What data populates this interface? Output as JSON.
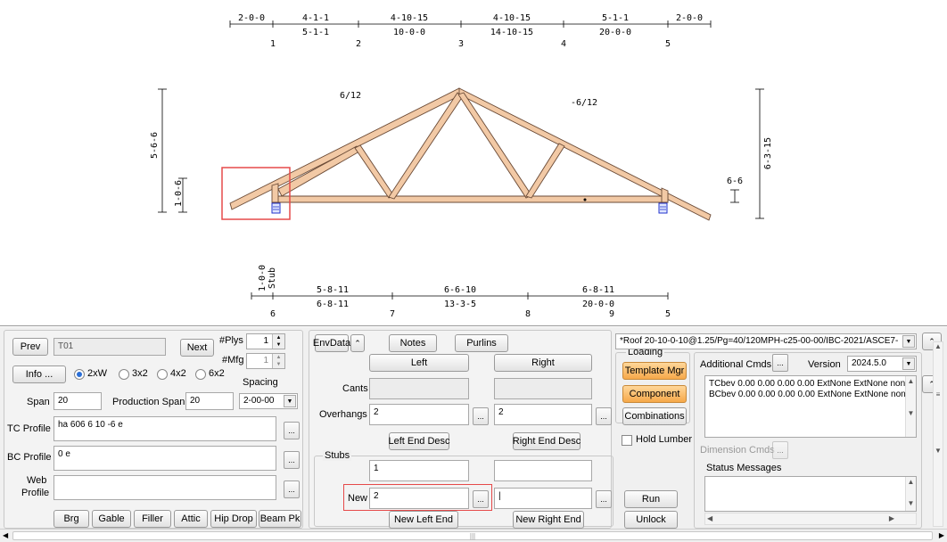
{
  "drawing": {
    "top_spans": [
      {
        "a": "2-0-0",
        "b": ""
      },
      {
        "a": "4-1-1",
        "b": "5-1-1"
      },
      {
        "a": "4-10-15",
        "b": "10-0-0"
      },
      {
        "a": "4-10-15",
        "b": "14-10-15"
      },
      {
        "a": "5-1-1",
        "b": "20-0-0"
      },
      {
        "a": "2-0-0",
        "b": ""
      }
    ],
    "top_joints": [
      "1",
      "2",
      "3",
      "4",
      "5"
    ],
    "pitch_left": "6/12",
    "pitch_right": "-6/12",
    "left_height": "5-6-6",
    "left_heel": "1-0-6",
    "right_height": "6-3-15",
    "right_heel": "6-6",
    "bottom_stub": "1-0-0",
    "bottom_stub_label": "Stub",
    "bottom_spans": [
      {
        "a": "5-8-11",
        "b": "6-8-11"
      },
      {
        "a": "6-6-10",
        "b": "13-3-5"
      },
      {
        "a": "6-8-11",
        "b": "20-0-0"
      }
    ],
    "bottom_joints": [
      "6",
      "7",
      "8",
      "9",
      "5"
    ]
  },
  "left": {
    "prev_label": "Prev",
    "truss_name": "T01",
    "next_label": "Next",
    "plys_label": "#Plys",
    "plys_value": "1",
    "mfg_label": "#Mfg",
    "mfg_value": "1",
    "info_label": "Info ...",
    "lumber_options": [
      "2xW",
      "3x2",
      "4x2",
      "6x2"
    ],
    "spacing_label": "Spacing",
    "span_label": "Span",
    "span_value": "20",
    "production_span_label": "Production Span",
    "production_span_value": "20",
    "spacing_value": "2-00-00",
    "tc_profile_label": "TC Profile",
    "tc_profile_value": "ha 606 6 10 -6 e",
    "bc_profile_label": "BC Profile",
    "bc_profile_value": "0 e",
    "web_profile_label1": "Web",
    "web_profile_label2": "Profile",
    "web_profile_value": "",
    "bottom_buttons": [
      "Brg",
      "Gable",
      "Filler",
      "Attic",
      "Hip Drop",
      "Beam Pk"
    ]
  },
  "middle": {
    "envdata_label": "EnvData",
    "notes_label": "Notes",
    "purlins_label": "Purlins",
    "left_tab": "Left",
    "right_tab": "Right",
    "cants_label": "Cants",
    "overhangs_label": "Overhangs",
    "overhang_left": "2",
    "overhang_right": "2",
    "left_end_desc": "Left End Desc",
    "right_end_desc": "Right End Desc",
    "stubs_label": "Stubs",
    "stub_left": "1",
    "stub_right": "",
    "new_label": "New",
    "new_left": "2",
    "new_right": "|",
    "new_left_end": "New Left End",
    "new_right_end": "New Right End"
  },
  "loading": {
    "label": "Loading",
    "template_mgr": "Template Mgr",
    "component": "Component",
    "combinations": "Combinations",
    "hold_lumber": "Hold Lumber",
    "run": "Run",
    "unlock": "Unlock"
  },
  "right": {
    "roof_combo": "*Roof 20-10-0-10@1.25/Pg=40/120MPH-c25-00-00/IBC-2021/ASCE7-",
    "additional_cmds_label": "Additional Cmds",
    "version_label": "Version",
    "version_value": "2024.5.0",
    "cmds_lines": [
      "TCbev 0.00 0.00 0.00 0.00 ExtNone ExtNone non",
      "BCbev 0.00 0.00 0.00 0.00 ExtNone ExtNone non"
    ],
    "dimension_cmds_label": "Dimension Cmds",
    "status_messages_label": "Status Messages"
  }
}
